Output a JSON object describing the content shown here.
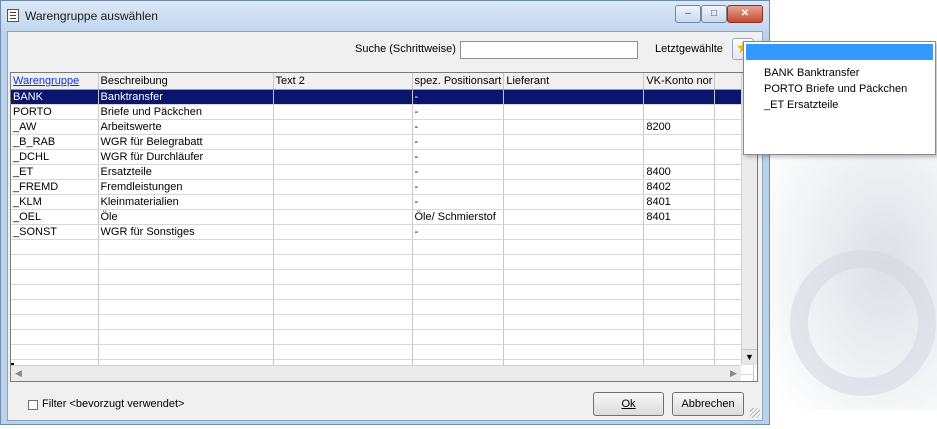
{
  "window": {
    "title": "Warengruppe auswählen"
  },
  "toolbar": {
    "search_label": "Suche (Schrittweise)",
    "search_value": "",
    "recent_label": "Letztgewählte"
  },
  "table": {
    "columns": [
      "Warengruppe",
      "Beschreibung",
      "Text 2",
      "spez. Positionsart",
      "Lieferant",
      "VK-Konto nor",
      ""
    ],
    "rows": [
      [
        "BANK",
        "Banktransfer",
        "",
        "-",
        "",
        "",
        ""
      ],
      [
        "PORTO",
        "Briefe und Päckchen",
        "",
        "-",
        "",
        "",
        ""
      ],
      [
        "_AW",
        "Arbeitswerte",
        "",
        "-",
        "",
        "8200",
        ""
      ],
      [
        "_B_RAB",
        "WGR für Belegrabatt",
        "",
        "-",
        "",
        "",
        ""
      ],
      [
        "_DCHL",
        "WGR für Durchläufer",
        "",
        "-",
        "",
        "",
        ""
      ],
      [
        "_ET",
        "Ersatzteile",
        "",
        "-",
        "",
        "8400",
        ""
      ],
      [
        "_FREMD",
        "Fremdleistungen",
        "",
        "-",
        "",
        "8402",
        ""
      ],
      [
        "_KLM",
        "Kleinmaterialien",
        "",
        "-",
        "",
        "8401",
        ""
      ],
      [
        "_OEL",
        "Öle",
        "",
        "Öle/ Schmierstof",
        "",
        "8401",
        ""
      ],
      [
        "_SONST",
        "WGR für Sonstiges",
        "",
        "-",
        "",
        "",
        ""
      ]
    ],
    "selected_row": 0,
    "empty_rows": 10
  },
  "footer": {
    "filter_label": "Filter <bevorzugt verwendet>",
    "filter_checked": false,
    "ok_label": "Ok",
    "cancel_label": "Abbrechen"
  },
  "recent_popup": {
    "items": [
      "BANK Banktransfer",
      "PORTO Briefe und Päckchen",
      "_ET Ersatzteile"
    ]
  },
  "colors": {
    "selection": "#0a166e",
    "sorted_header": "#0b33d6",
    "popup_highlight": "#3399ff"
  }
}
